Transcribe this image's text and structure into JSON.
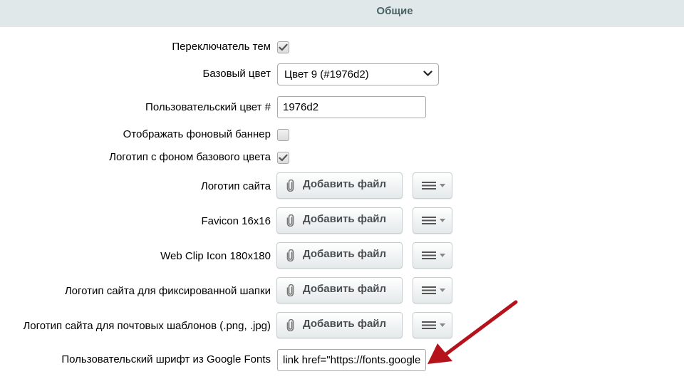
{
  "section": {
    "title": "Общие"
  },
  "settings": {
    "theme_switcher": {
      "label": "Переключатель тем",
      "checked": true
    },
    "base_color": {
      "label": "Базовый цвет",
      "value": "Цвет 9 (#1976d2)"
    },
    "custom_color": {
      "label": "Пользовательский цвет #",
      "value": "1976d2"
    },
    "show_banner": {
      "label": "Отображать фоновый баннер",
      "checked": false
    },
    "logo_bg": {
      "label": "Логотип с фоном базового цвета",
      "checked": true
    },
    "files": [
      {
        "label": "Логотип сайта",
        "button": "Добавить файл"
      },
      {
        "label": "Favicon 16x16",
        "button": "Добавить файл"
      },
      {
        "label": "Web Clip Icon 180x180",
        "button": "Добавить файл"
      },
      {
        "label": "Логотип сайта для фиксированной шапки",
        "button": "Добавить файл"
      },
      {
        "label": "Логотип сайта для почтовых шаблонов (.png, .jpg)",
        "button": "Добавить файл"
      }
    ],
    "google_font": {
      "label": "Пользовательский шрифт из Google Fonts",
      "value": "link href=\"https://fonts.google"
    }
  },
  "icons": {
    "checkmark": "check-icon",
    "chevron": "chevron-down-icon",
    "attach": "paperclip-icon",
    "menu": "hamburger-icon",
    "dropdown": "caret-down-icon"
  },
  "colors": {
    "header_bg": "#e0e8ea",
    "header_text": "#4b6267",
    "annotation_arrow": "#b5121b"
  }
}
